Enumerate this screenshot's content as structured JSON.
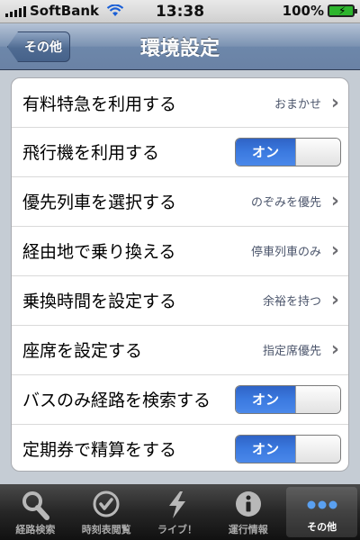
{
  "status_bar": {
    "carrier": "SoftBank",
    "time": "13:38",
    "battery": "100%"
  },
  "nav": {
    "back_label": "その他",
    "title": "環境設定"
  },
  "settings": [
    {
      "label": "有料特急を利用する",
      "value": "おまかせ",
      "type": "disclosure"
    },
    {
      "label": "飛行機を利用する",
      "value": "オン",
      "type": "toggle"
    },
    {
      "label": "優先列車を選択する",
      "value": "のぞみを優先",
      "type": "disclosure"
    },
    {
      "label": "経由地で乗り換える",
      "value": "停車列車のみ",
      "type": "disclosure"
    },
    {
      "label": "乗換時間を設定する",
      "value": "余裕を持つ",
      "type": "disclosure"
    },
    {
      "label": "座席を設定する",
      "value": "指定席優先",
      "type": "disclosure"
    },
    {
      "label": "バスのみ経路を検索する",
      "value": "オン",
      "type": "toggle"
    },
    {
      "label": "定期券で精算をする",
      "value": "オン",
      "type": "toggle"
    }
  ],
  "tabs": [
    {
      "label": "経路検索",
      "icon": "search-icon",
      "active": false
    },
    {
      "label": "時刻表閲覧",
      "icon": "clock-icon",
      "active": false
    },
    {
      "label": "ライブ！",
      "icon": "lightning-icon",
      "active": false
    },
    {
      "label": "運行情報",
      "icon": "info-icon",
      "active": false
    },
    {
      "label": "その他",
      "icon": "more-icon",
      "active": true
    }
  ],
  "colors": {
    "toggle_on": "#3b7ae0",
    "nav_bar": "#6d87aa",
    "background": "#c5ccd4"
  }
}
